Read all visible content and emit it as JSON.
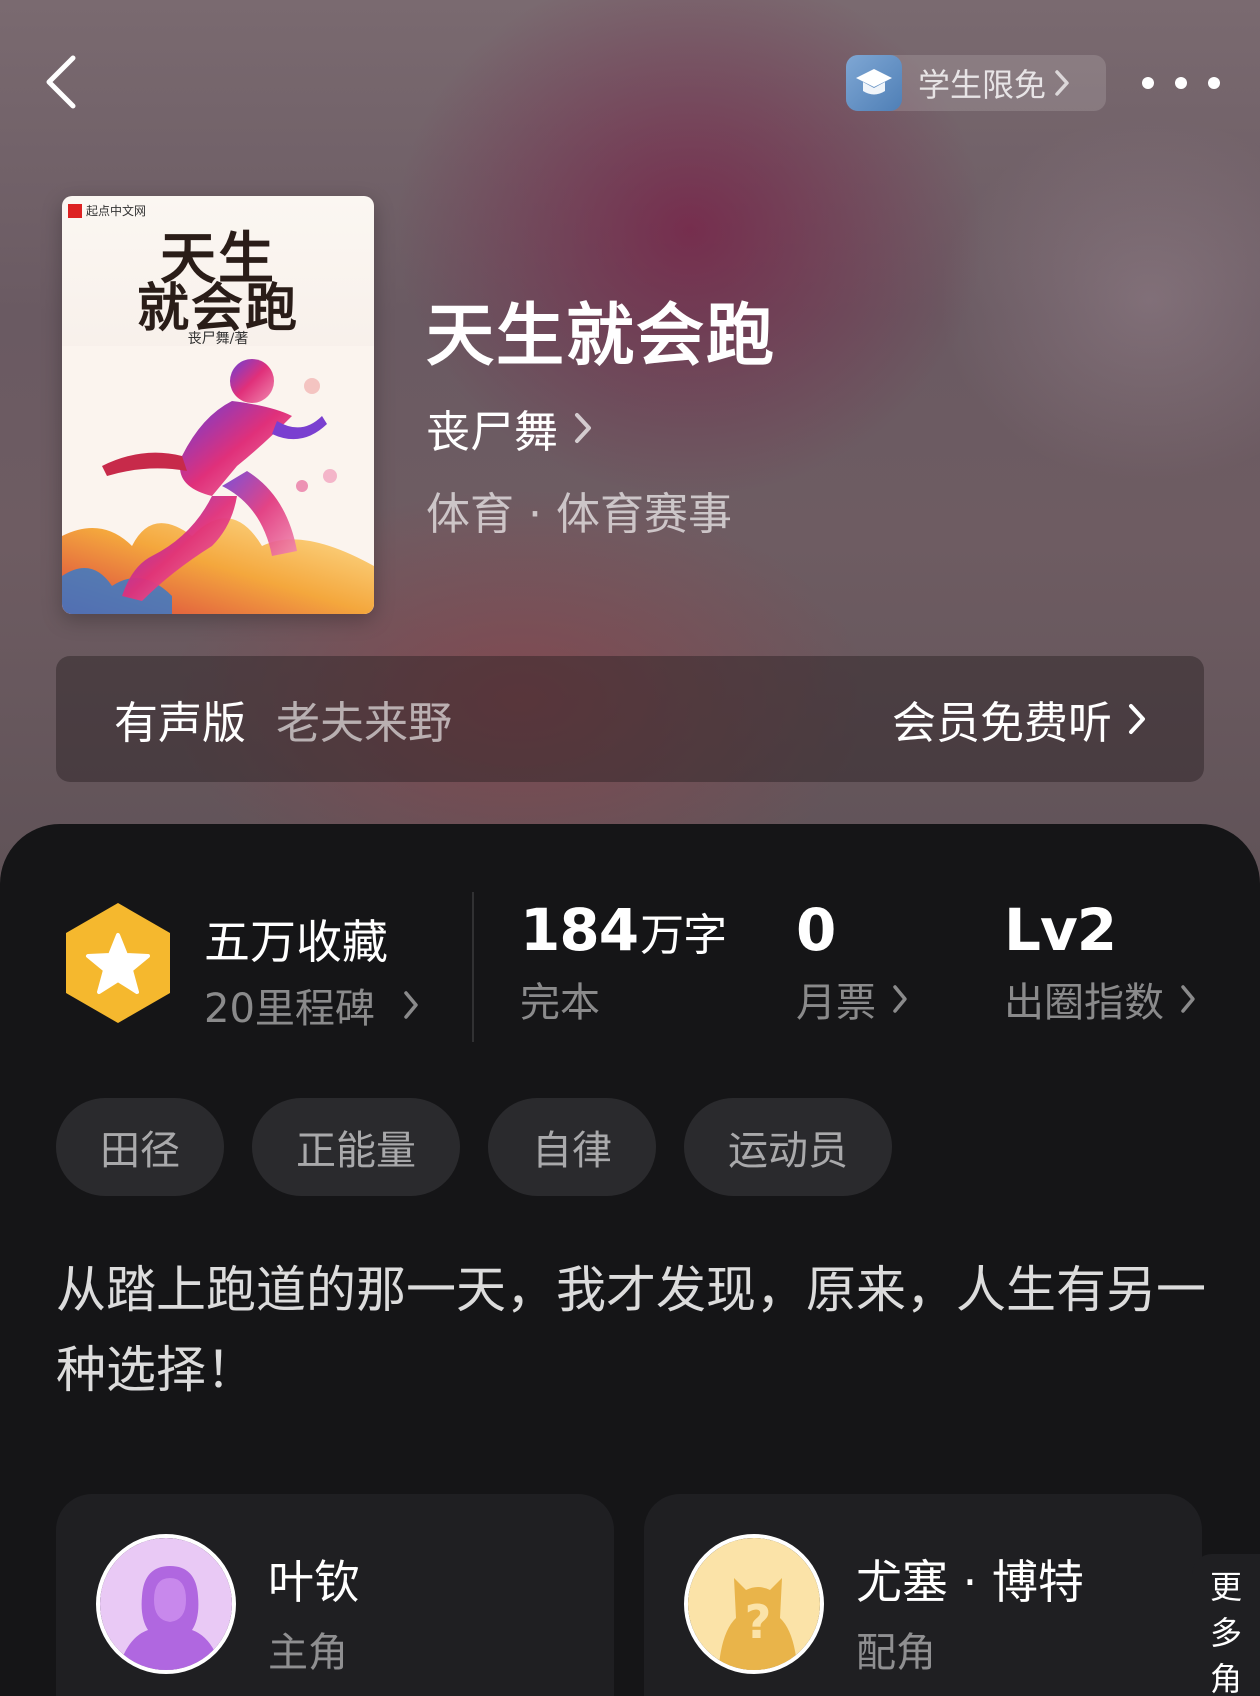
{
  "header": {
    "student_badge": "学生限免"
  },
  "book": {
    "cover": {
      "publisher": "起点中文网",
      "title_line1": "天生",
      "title_line2": "就会跑",
      "author": "丧尸舞/著"
    },
    "title": "天生就会跑",
    "author": "丧尸舞",
    "genre": "体育 · 体育赛事"
  },
  "audio": {
    "label": "有声版",
    "narrator": "老夫来野",
    "action": "会员免费听"
  },
  "stats": {
    "favorites_title": "五万收藏",
    "milestone": "20里程碑",
    "word_count_value": "184",
    "word_count_unit": "万字",
    "status": "完本",
    "monthly_votes_value": "0",
    "monthly_votes_label": "月票",
    "level_value": "Lv2",
    "level_label": "出圈指数"
  },
  "tags": [
    "田径",
    "正能量",
    "自律",
    "运动员"
  ],
  "synopsis": "从踏上跑道的那一天，我才发现，原来，人生有另一种选择！",
  "roles": [
    {
      "name": "叶钦",
      "type": "主角"
    },
    {
      "name": "尤塞 · 博特",
      "type": "配角"
    }
  ],
  "more_roles_label": [
    "更",
    "多",
    "角"
  ],
  "colors": {
    "badge_gold": "#f5b82e",
    "panel_bg": "#151517",
    "card_bg": "#1f1f22",
    "tag_bg": "#2a2a2d"
  }
}
